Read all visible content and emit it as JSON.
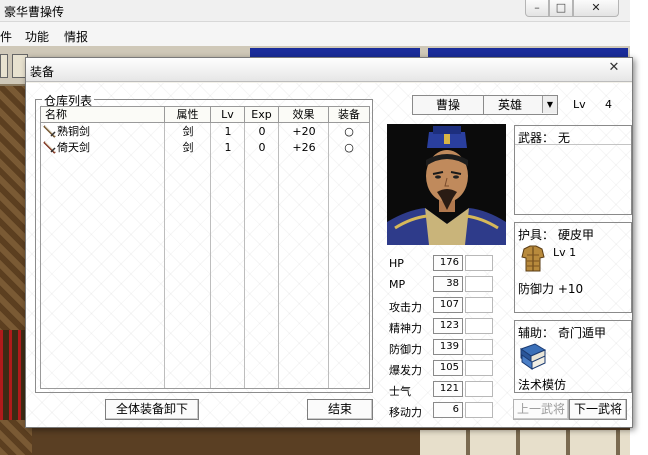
{
  "background": {
    "title": "豪华曹操传",
    "menu": [
      "件",
      "功能",
      "情报"
    ],
    "colors": {
      "banner": "#1a2c9a",
      "scene": "#5a3f23"
    }
  },
  "dialog": {
    "title": "装备",
    "storage": {
      "legend": "仓库列表",
      "columns": [
        "名称",
        "属性",
        "Lv",
        "Exp",
        "效果",
        "装备"
      ],
      "rows": [
        {
          "name": "熟铜剑",
          "attr": "剑",
          "lv": "1",
          "exp": "0",
          "effect": "+20",
          "equip": "○",
          "icon": "sword-icon"
        },
        {
          "name": "倚天剑",
          "attr": "剑",
          "lv": "1",
          "exp": "0",
          "effect": "+26",
          "equip": "○",
          "icon": "sword-icon"
        }
      ],
      "unequip_all": "全体装备卸下",
      "end": "结束"
    },
    "character": {
      "name": "曹操",
      "class": "英雄",
      "lv_label": "Lv",
      "lv_value": "4"
    },
    "stats": [
      {
        "label": "HP",
        "value": "176"
      },
      {
        "label": "MP",
        "value": "38"
      },
      {
        "label": "攻击力",
        "value": "107"
      },
      {
        "label": "精神力",
        "value": "123"
      },
      {
        "label": "防御力",
        "value": "139"
      },
      {
        "label": "爆发力",
        "value": "105"
      },
      {
        "label": "士气",
        "value": "121"
      },
      {
        "label": "移动力",
        "value": "6"
      }
    ],
    "slots": {
      "weapon": {
        "label": "武器：",
        "value": "无"
      },
      "armor": {
        "label": "护具：",
        "value": "硬皮甲",
        "lv": "Lv 1",
        "stat": "防御力 +10",
        "icon": "armor-icon"
      },
      "accessory": {
        "label": "辅助：",
        "value": "奇门遁甲",
        "stat": "法术模仿",
        "icon": "book-icon"
      }
    },
    "prev_general": "上一武将",
    "next_general": "下一武将"
  }
}
